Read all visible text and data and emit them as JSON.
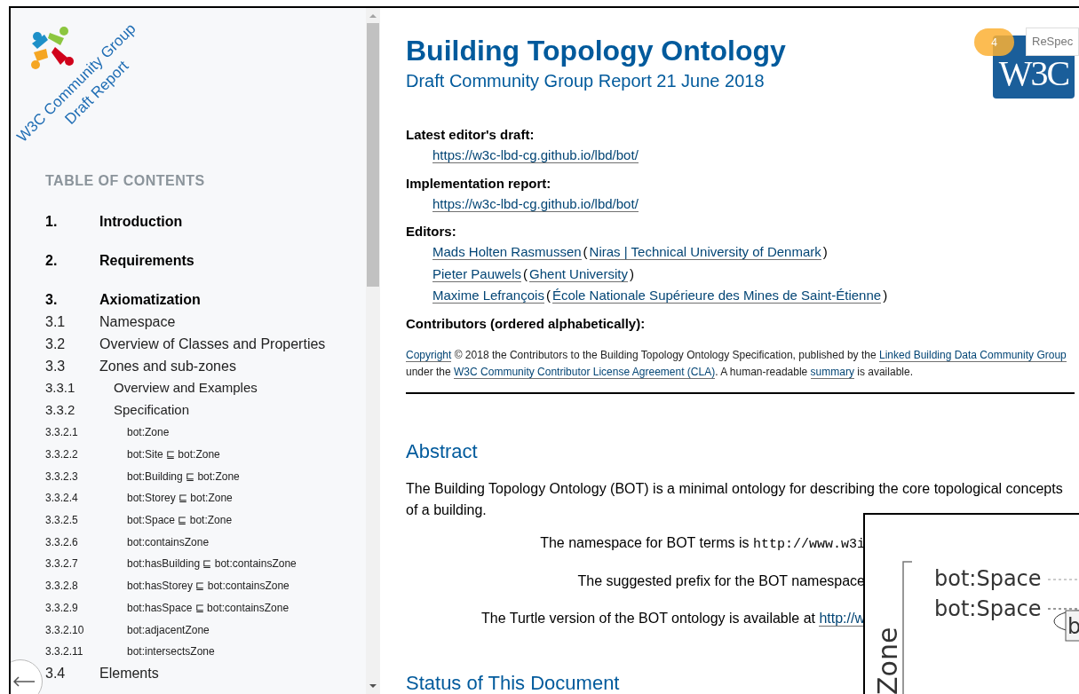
{
  "sidebar": {
    "logo": {
      "line_1": "W3C Community Group",
      "line_2": "Draft Report"
    },
    "toc_title": "TABLE OF CONTENTS",
    "toc": [
      {
        "number": "1.",
        "label": "Introduction"
      },
      {
        "number": "2.",
        "label": "Requirements"
      },
      {
        "number": "3.",
        "label": "Axiomatization",
        "children": [
          {
            "number": "3.1",
            "label": "Namespace"
          },
          {
            "number": "3.2",
            "label": "Overview of Classes and Properties"
          },
          {
            "number": "3.3",
            "label": "Zones and sub-zones",
            "children": [
              {
                "number": "3.3.1",
                "label": "Overview and Examples"
              },
              {
                "number": "3.3.2",
                "label": "Specification",
                "children": [
                  {
                    "number": "3.3.2.1",
                    "label": "bot:Zone"
                  },
                  {
                    "number": "3.3.2.2",
                    "label": "bot:Site ⊑ bot:Zone"
                  },
                  {
                    "number": "3.3.2.3",
                    "label": "bot:Building ⊑ bot:Zone"
                  },
                  {
                    "number": "3.3.2.4",
                    "label": "bot:Storey ⊑ bot:Zone"
                  },
                  {
                    "number": "3.3.2.5",
                    "label": "bot:Space ⊑ bot:Zone"
                  },
                  {
                    "number": "3.3.2.6",
                    "label": "bot:containsZone"
                  },
                  {
                    "number": "3.3.2.7",
                    "label": "bot:hasBuilding ⊑ bot:containsZone"
                  },
                  {
                    "number": "3.3.2.8",
                    "label": "bot:hasStorey ⊑ bot:containsZone"
                  },
                  {
                    "number": "3.3.2.9",
                    "label": "bot:hasSpace ⊑ bot:containsZone"
                  },
                  {
                    "number": "3.3.2.10",
                    "label": "bot:adjacentZone"
                  },
                  {
                    "number": "3.3.2.11",
                    "label": "bot:intersectsZone"
                  }
                ]
              }
            ]
          },
          {
            "number": "3.4",
            "label": "Elements"
          }
        ]
      }
    ]
  },
  "header": {
    "title": "Building Topology Ontology",
    "subtitle": "Draft Community Group Report 21 June 2018",
    "logo": "W3C",
    "badge": "4",
    "respec_button": "ReSpec"
  },
  "metadata": [
    {
      "term": "Latest editor's draft:",
      "entries": [
        [
          {
            "kind": "link",
            "text": "https://w3c-lbd-cg.github.io/lbd/bot/"
          }
        ]
      ]
    },
    {
      "term": "Implementation report:",
      "entries": [
        [
          {
            "kind": "link",
            "text": "https://w3c-lbd-cg.github.io/lbd/bot/"
          }
        ]
      ]
    },
    {
      "term": "Editors:",
      "entries": [
        [
          {
            "kind": "link",
            "text": "Mads Holten Rasmussen"
          },
          {
            "kind": "text",
            "text": "("
          },
          {
            "kind": "link",
            "text": "Niras | Technical University of Denmark"
          },
          {
            "kind": "text",
            "text": ")"
          }
        ],
        [
          {
            "kind": "link",
            "text": "Pieter Pauwels"
          },
          {
            "kind": "text",
            "text": "("
          },
          {
            "kind": "link",
            "text": "Ghent University"
          },
          {
            "kind": "text",
            "text": ")"
          }
        ],
        [
          {
            "kind": "link",
            "text": "Maxime Lefrançois"
          },
          {
            "kind": "text",
            "text": "("
          },
          {
            "kind": "link",
            "text": "École Nationale Supérieure des Mines de Saint-Étienne"
          },
          {
            "kind": "text",
            "text": ")"
          }
        ]
      ]
    },
    {
      "term": "Contributors (ordered alphabetically):"
    }
  ],
  "copyright": [
    {
      "kind": "link",
      "text": "Copyright"
    },
    {
      "kind": "text",
      "text": " © 2018 the Contributors to the Building Topology Ontology Specification, published by the "
    },
    {
      "kind": "link",
      "text": "Linked Building Data Community Group"
    },
    {
      "kind": "text",
      "text": " under the "
    },
    {
      "kind": "link",
      "text": "W3C Community Contributor License Agreement (CLA)"
    },
    {
      "kind": "text",
      "text": ". A human-readable "
    },
    {
      "kind": "link",
      "text": "summary"
    },
    {
      "kind": "text",
      "text": " is available."
    }
  ],
  "abstract": {
    "heading": "Abstract",
    "paragraph": "The Building Topology Ontology (BOT) is a minimal ontology for describing the core topological concepts of a building.",
    "lines": [
      [
        {
          "kind": "text",
          "text": "The namespace for BOT terms is "
        },
        {
          "kind": "code",
          "text": "http://www.w3i"
        }
      ],
      [
        {
          "kind": "text",
          "text": "The suggested prefix for the BOT namespace"
        }
      ],
      [
        {
          "kind": "text",
          "text": "The Turtle version of the BOT ontology is available at "
        },
        {
          "kind": "link",
          "text": "http://w"
        }
      ]
    ]
  },
  "figure": {
    "axis_label": "Zone",
    "labels": [
      "bot:Space",
      "bot:Space"
    ],
    "box_label": "b"
  },
  "status_heading": "Status of This Document"
}
